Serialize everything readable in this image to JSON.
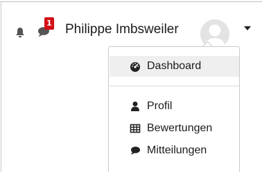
{
  "navbar": {
    "notification_icon": "bell-icon",
    "messages_icon": "chat-bubble-icon",
    "message_count": "1",
    "badge_color": "#d20f16",
    "user_name": "Philippe Imbsweiler",
    "avatar_icon": "default-user-avatar",
    "menu_toggle_icon": "caret-down-icon"
  },
  "user_menu": {
    "items": [
      {
        "label": "Dashboard",
        "icon": "tachometer-icon",
        "active": true
      },
      {
        "label": "Profil",
        "icon": "user-icon"
      },
      {
        "label": "Bewertungen",
        "icon": "table-icon"
      },
      {
        "label": "Mitteilungen",
        "icon": "comment-icon"
      }
    ]
  }
}
